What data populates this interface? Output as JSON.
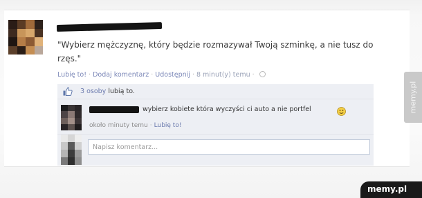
{
  "post": {
    "text": "\"Wybierz mężczyznę, który będzie rozmazywał Twoją szminkę, a nie tusz do rzęs.\"",
    "actions": {
      "like": "Lubię to!",
      "comment": "Dodaj komentarz",
      "share": "Udostępnij",
      "time": "8 minut(y) temu",
      "separator": "·"
    }
  },
  "likes": {
    "count": "3 osoby",
    "suffix": "lubią to."
  },
  "comment": {
    "text": "wybierz kobiete która wyczyści ci auto a nie portfel",
    "time": "około minuty temu",
    "like": "Lubię to!",
    "separator": "·"
  },
  "write_comment": {
    "placeholder": "Napisz komentarz..."
  },
  "watermark": {
    "side": "memy.pl",
    "badge": "memy.pl"
  },
  "icons": {
    "like": "thumbs-up-icon",
    "privacy": "globe-icon",
    "emoticon": "smiley-icon"
  },
  "colors": {
    "link": "#6a79ad",
    "comment_bg": "#edeff4",
    "text": "#333333"
  }
}
